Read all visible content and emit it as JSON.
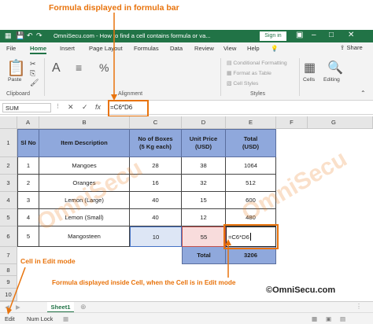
{
  "annotations": {
    "formula_bar_note": "Formula displayed  in formula bar",
    "cell_edit_note": "Cell in Edit mode",
    "formula_cell_note": "Formula displayed inside Cell, when the Cell is in Edit mode",
    "logo": "©OmniSecu.com"
  },
  "window": {
    "title": "OmniSecu.com - How to find a cell contains formula or va...",
    "sign_in": "Sign in",
    "accent": "#217346"
  },
  "tabs": [
    "File",
    "Home",
    "Insert",
    "Page Layout",
    "Formulas",
    "Data",
    "Review",
    "View",
    "Help"
  ],
  "active_tab": "Home",
  "share": "Share",
  "ribbon": {
    "paste": "Paste",
    "clipboard": "Clipboard",
    "alignment": "Alignment",
    "conditional_formatting": "Conditional Formatting",
    "format_as_table": "Format as Table",
    "cell_styles": "Cell Styles",
    "styles": "Styles",
    "cells": "Cells",
    "editing": "Editing"
  },
  "formula_bar": {
    "name_box": "SUM",
    "cancel": "✕",
    "enter": "✓",
    "fx": "fx",
    "formula": "=C6*D6"
  },
  "columns": [
    "A",
    "B",
    "C",
    "D",
    "E",
    "F",
    "G"
  ],
  "rows": [
    "1",
    "2",
    "3",
    "4",
    "5",
    "6",
    "7",
    "8",
    "9",
    "10"
  ],
  "table": {
    "headers": [
      "Sl No",
      "Item Description",
      "No of Boxes (5 Kg each)",
      "Unit Price (USD)",
      "Total (USD)"
    ],
    "data": [
      [
        "1",
        "Mangoes",
        "28",
        "38",
        "1064"
      ],
      [
        "2",
        "Oranges",
        "16",
        "32",
        "512"
      ],
      [
        "3",
        "Lemon (Large)",
        "40",
        "15",
        "600"
      ],
      [
        "4",
        "Lemon (Small)",
        "40",
        "12",
        "480"
      ],
      [
        "5",
        "Mangosteen",
        "10",
        "55",
        "=C6*D6"
      ]
    ],
    "total_label": "Total",
    "total_value": "3206",
    "header_color": "#8fa8dc"
  },
  "sheet_tab": "Sheet1",
  "status": {
    "mode": "Edit",
    "num_lock": "Num Lock"
  },
  "watermark": "OmniSecu.com"
}
